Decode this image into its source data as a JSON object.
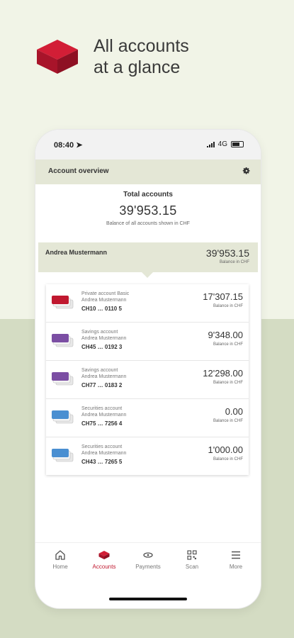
{
  "promo": {
    "title_line1": "All accounts",
    "title_line2": "at a glance"
  },
  "status": {
    "time": "08:40",
    "network": "4G"
  },
  "appbar": {
    "title": "Account overview"
  },
  "totals": {
    "label": "Total accounts",
    "amount": "39'953.15",
    "note": "Balance of all accounts shown in CHF"
  },
  "owner": {
    "name": "Andrea Mustermann",
    "amount": "39'953.15",
    "note": "Balance in CHF"
  },
  "accounts": [
    {
      "type": "Private account Basic",
      "holder": "Andrea Mustermann",
      "iban": "CH10 … 0110 5",
      "amount": "17'307.15",
      "note": "Balance in CHF"
    },
    {
      "type": "Savings account",
      "holder": "Andrea Mustermann",
      "iban": "CH45 … 0192 3",
      "amount": "9'348.00",
      "note": "Balance in CHF"
    },
    {
      "type": "Savings account",
      "holder": "Andrea Mustermann",
      "iban": "CH77 … 0183 2",
      "amount": "12'298.00",
      "note": "Balance in CHF"
    },
    {
      "type": "Securities account",
      "holder": "Andrea Mustermann",
      "iban": "CH75 … 7256 4",
      "amount": "0.00",
      "note": "Balance in CHF"
    },
    {
      "type": "Securities account",
      "holder": "Andrea Mustermann",
      "iban": "CH43 … 7265 5",
      "amount": "1'000.00",
      "note": "Balance in CHF"
    }
  ],
  "tabs": [
    {
      "label": "Home",
      "icon": "home-icon"
    },
    {
      "label": "Accounts",
      "icon": "accounts-icon"
    },
    {
      "label": "Payments",
      "icon": "payments-icon"
    },
    {
      "label": "Scan",
      "icon": "scan-icon"
    },
    {
      "label": "More",
      "icon": "menu-icon"
    }
  ],
  "colors": {
    "brand_red": "#c0182f",
    "savings_purple": "#7b4ea3",
    "securities_blue": "#4a8fd1",
    "panel_green": "#e4e7d6"
  }
}
